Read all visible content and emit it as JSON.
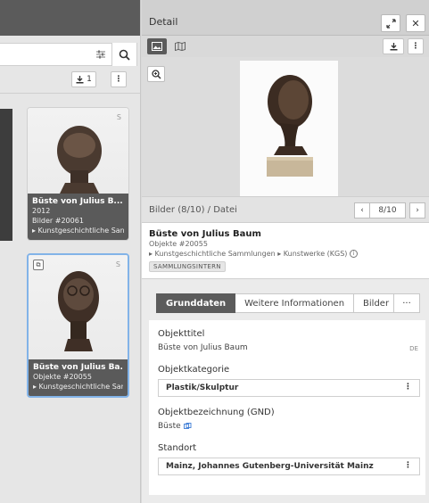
{
  "left": {
    "results_count": "1",
    "cards": [
      {
        "badge": "S",
        "title": "Büste von Julius B...",
        "line1": "2012",
        "line2": "Bilder  #20061",
        "line3": "▸ Kunstgeschichtliche San"
      },
      {
        "badge": "S",
        "title": "Büste von Julius Ba...",
        "line1": "Objekte  #20055",
        "line2": "▸ Kunstgeschichtliche Samı"
      }
    ]
  },
  "detail": {
    "title": "Detail",
    "pager_label": "Bilder (8/10) / Datei",
    "pager_value": "8/10",
    "object": {
      "title": "Büste von Julius Baum",
      "type_id": "Objekte  #20055",
      "path": "▸ Kunstgeschichtliche Sammlungen ▸ Kunstwerke (KGS)",
      "tag": "SAMMLUNGSINTERN"
    },
    "tabs": [
      {
        "label": "Grunddaten"
      },
      {
        "label": "Weitere Informationen"
      },
      {
        "label": "Bilder"
      }
    ],
    "tab_more": "···",
    "fields": {
      "objekttitel_label": "Objekttitel",
      "objekttitel_value": "Büste von Julius Baum",
      "objekttitel_lang": "DE",
      "kategorie_label": "Objektkategorie",
      "kategorie_value": "Plastik/Skulptur",
      "gnd_label": "Objektbezeichnung (GND)",
      "gnd_value": "Büste",
      "standort_label": "Standort",
      "standort_value": "Mainz, Johannes Gutenberg-Universität Mainz"
    }
  },
  "colors": {
    "active_tab": "#5b5b5b",
    "selected_card_border": "#82b3e8",
    "caption_bg": "#464646"
  }
}
